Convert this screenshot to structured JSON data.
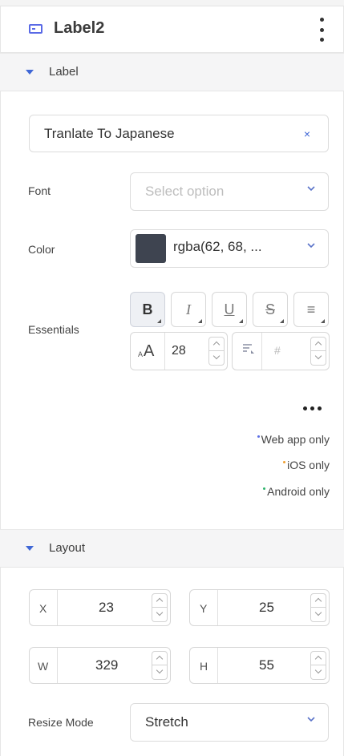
{
  "header": {
    "title": "Label2",
    "icon": "label-component-icon",
    "menu_icon": "kebab-menu-icon"
  },
  "label_section": {
    "title": "Label",
    "text_value": "Tranlate To Japanese",
    "clear_glyph": "×",
    "font": {
      "label": "Font",
      "placeholder": "Select option"
    },
    "color": {
      "label": "Color",
      "value": "rgba(62, 68, ...",
      "swatch": "#3e4450"
    },
    "essentials": {
      "label": "Essentials",
      "bold": "B",
      "italic": "I",
      "underline": "U",
      "strike": "S",
      "align": "≡",
      "font_size_glyph": "A",
      "font_size_small": "A",
      "font_size": "28",
      "line_height_glyph": "#"
    },
    "more_icon": "more-options-icon",
    "notes": {
      "web": "Web app only",
      "ios": "iOS only",
      "android": "Android only",
      "web_color": "#5b6de6",
      "ios_color": "#f0a030",
      "android_color": "#2db36b"
    }
  },
  "layout_section": {
    "title": "Layout",
    "x_label": "X",
    "x": "23",
    "y_label": "Y",
    "y": "25",
    "w_label": "W",
    "w": "329",
    "h_label": "H",
    "h": "55",
    "resize_label": "Resize Mode",
    "resize_value": "Stretch"
  },
  "colors": {
    "accent": "#3f67d6",
    "section_bg": "#f5f5f6"
  }
}
